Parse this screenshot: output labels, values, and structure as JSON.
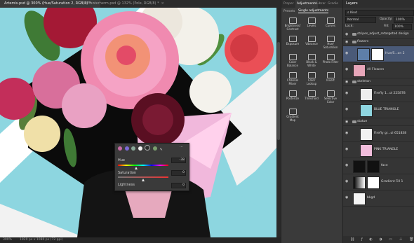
{
  "tabs": [
    {
      "label": "Artemis.psd @ 300% (Hue/Saturation 2, RGB/8) *",
      "close": "×"
    },
    {
      "label": "ePlanterherm.psd @ 132% (Pole, RGB/8) *",
      "close": "×"
    }
  ],
  "status": {
    "zoom": "300%",
    "doc": "1920 px x 1080 px (72 ppi)"
  },
  "props": {
    "preset_label": "Hue",
    "hue": {
      "label": "Hue",
      "value": "-38"
    },
    "saturation": {
      "label": "Saturation",
      "value": "0"
    },
    "lightness": {
      "label": "Lightness",
      "value": "0"
    }
  },
  "midpanel": {
    "tabs": [
      "Proper",
      "Adjustments",
      "Librar",
      "Gradie"
    ],
    "subtabs": [
      "Presets",
      "Single adjustments"
    ],
    "items": [
      "Brightness/\nContrast",
      "Levels",
      "Curves",
      "Exposure",
      "Vibrance",
      "Hue/\nSaturation",
      "Color\nBalance",
      "Black &\nWhite",
      "Photo Filter",
      "Channel\nMixer",
      "Color\nLookup",
      "Invert",
      "Posterize",
      "Threshold",
      "Selective\nColor",
      "Gradient\nMap"
    ]
  },
  "layers": {
    "tab": "Layers",
    "kind": "Kind",
    "blend": "Normal",
    "opacity_label": "Opacity:",
    "opacity": "100%",
    "lock_label": "Lock:",
    "fill_label": "Fill:",
    "fill": "100%",
    "rows": [
      {
        "type": "group",
        "label": "stripes_adjust_retargeted design"
      },
      {
        "type": "group",
        "label": "flowers"
      },
      {
        "type": "layer",
        "label": "Hue/S...on 2",
        "selected": true
      },
      {
        "type": "layer",
        "label": "All Flowers"
      },
      {
        "type": "group",
        "label": "skeleton"
      },
      {
        "type": "layer",
        "label": "Firefly 1...ol 225878"
      },
      {
        "type": "layer",
        "label": "BLUE TRIANGLE"
      },
      {
        "type": "group",
        "label": "statue"
      },
      {
        "type": "layer",
        "label": "Firefly gr...ol 651838"
      },
      {
        "type": "layer",
        "label": "PINK TRIANGLE"
      },
      {
        "type": "layer",
        "label": "face"
      },
      {
        "type": "layer",
        "label": "Gradient Fill 1"
      },
      {
        "type": "layer",
        "label": "bkgd"
      }
    ]
  }
}
